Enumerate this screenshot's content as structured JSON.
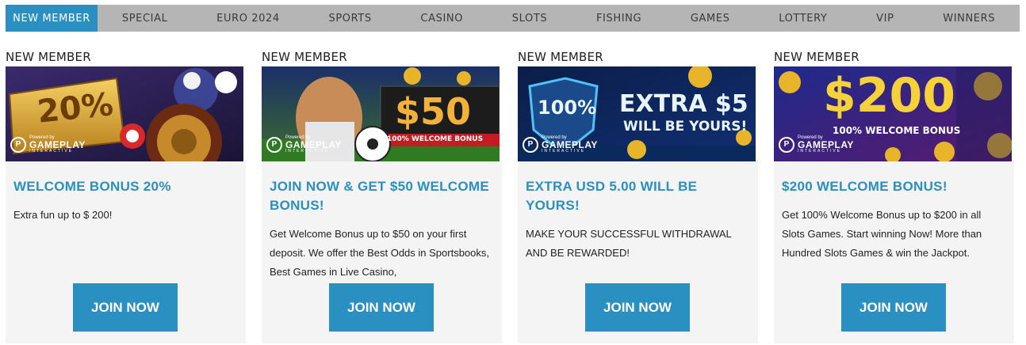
{
  "nav": {
    "tabs": [
      "NEW MEMBER",
      "SPECIAL",
      "EURO 2024",
      "SPORTS",
      "CASINO",
      "SLOTS",
      "FISHING",
      "GAMES",
      "LOTTERY",
      "VIP",
      "WINNERS"
    ],
    "active": "NEW MEMBER"
  },
  "colors": {
    "accent": "#2a8fc1",
    "nav_bg": "#b5b5b5",
    "card_bg": "#f4f4f4"
  },
  "logo": {
    "powered": "Powered by",
    "name": "GAMEPLAY",
    "sub": "INTERACTIVE"
  },
  "cards": [
    {
      "category": "NEW MEMBER",
      "banner_text": "20%",
      "title": "WELCOME BONUS 20%",
      "description": "Extra fun up to $ 200!",
      "button": "JOIN NOW"
    },
    {
      "category": "NEW MEMBER",
      "banner_text": "$50",
      "banner_sub": "100% WELCOME BONUS",
      "title": "JOIN NOW & GET $50 WELCOME BONUS!",
      "description": "Get Welcome Bonus up to $50 on your first deposit. We offer the Best Odds in Sportsbooks, Best Games in Live Casino,",
      "button": "JOIN NOW"
    },
    {
      "category": "NEW MEMBER",
      "banner_text": "EXTRA $5",
      "banner_badge": "100%",
      "banner_sub": "WILL BE YOURS!",
      "title": "EXTRA USD 5.00 WILL BE YOURS!",
      "description": "MAKE YOUR SUCCESSFUL WITHDRAWAL AND BE REWARDED!",
      "button": "JOIN NOW"
    },
    {
      "category": "NEW MEMBER",
      "banner_text": "$200",
      "banner_sub": "100% WELCOME BONUS",
      "title": "$200 WELCOME BONUS!",
      "description": "Get 100% Welcome Bonus up to $200 in all Slots Games. Start winning Now! More than Hundred Slots Games & win the Jackpot.",
      "button": "JOIN NOW"
    }
  ]
}
